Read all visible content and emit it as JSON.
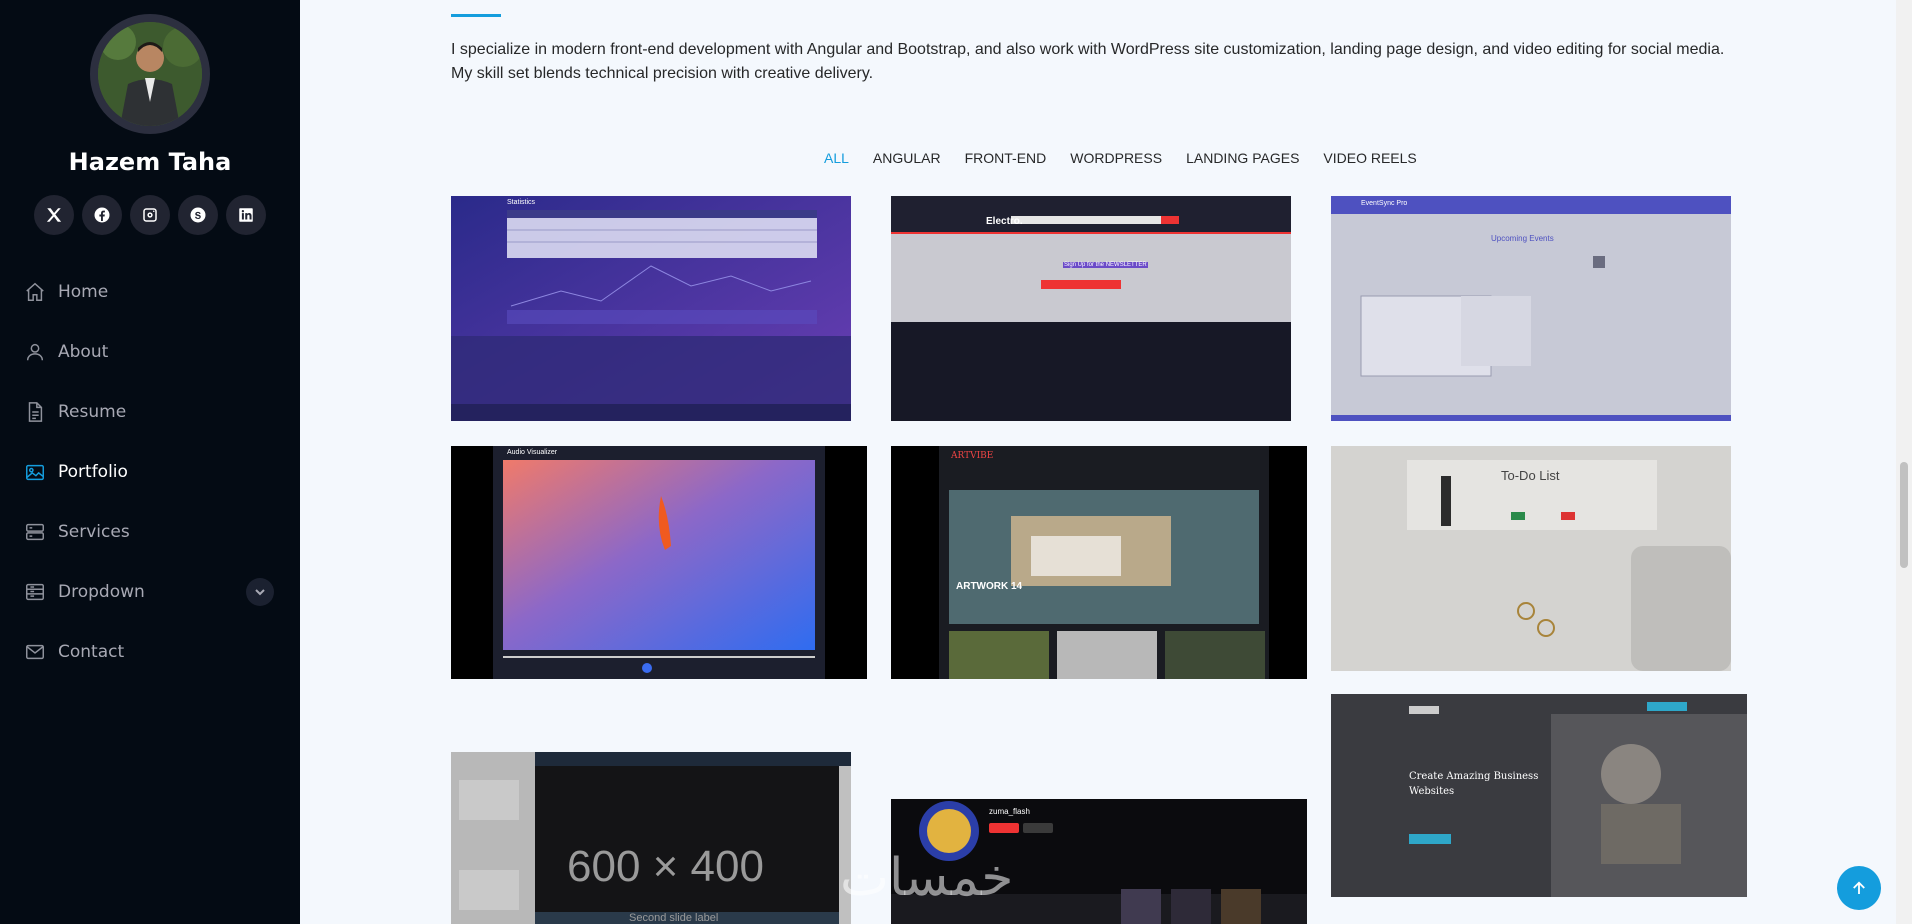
{
  "profile": {
    "name": "Hazem Taha"
  },
  "socials": [
    {
      "icon": "x-twitter-icon"
    },
    {
      "icon": "facebook-icon"
    },
    {
      "icon": "instagram-icon"
    },
    {
      "icon": "skype-icon"
    },
    {
      "icon": "linkedin-icon"
    }
  ],
  "nav": {
    "home": "Home",
    "about": "About",
    "resume": "Resume",
    "portfolio": "Portfolio",
    "services": "Services",
    "dropdown": "Dropdown",
    "contact": "Contact"
  },
  "intro": "I specialize in modern front-end development with Angular and Bootstrap, and also work with WordPress site customization, landing page design, and video editing for social media. My skill set blends technical precision with creative delivery.",
  "filters": {
    "all": "ALL",
    "angular": "ANGULAR",
    "frontend": "FRONT-END",
    "wordpress": "WORDPRESS",
    "landing": "LANDING PAGES",
    "reels": "VIDEO REELS"
  },
  "cards": {
    "statistics": "Statistics",
    "electro": "Electro.",
    "newsletter": "Sign Up for the NEWSLETTER",
    "eventsync": "EventSync Pro",
    "upcoming": "Upcoming Events",
    "audio": "Audio Visualizer",
    "artvibe": "ARTVIBE",
    "artwork": "ARTWORK 14",
    "todo": "To-Do List",
    "agency_headline": "Create Amazing Business Websites",
    "placeholder": "600 × 400",
    "slide_label": "Second slide label",
    "zuma": "zuma_flash"
  },
  "watermark": "خمسات",
  "colors": {
    "accent": "#149ddd",
    "sidebar": "#040b14"
  }
}
